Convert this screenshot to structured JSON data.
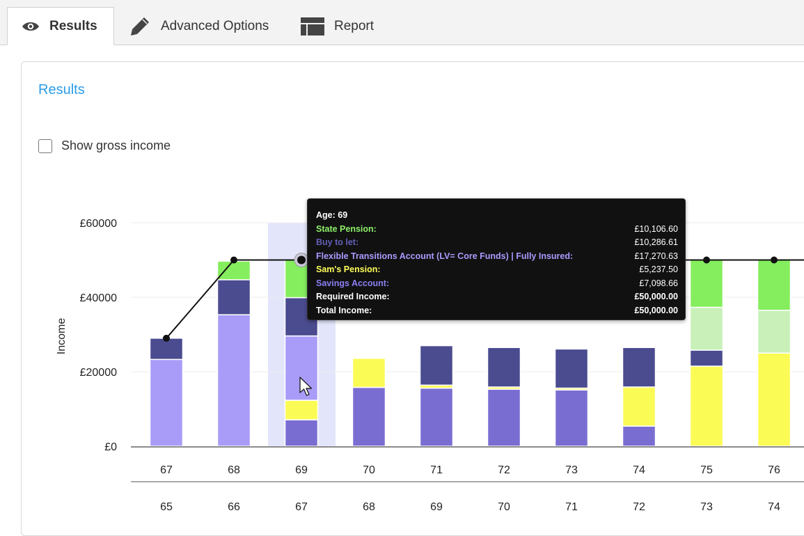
{
  "tabs": [
    {
      "label": "Results",
      "icon": "eye-icon",
      "active": true
    },
    {
      "label": "Advanced Options",
      "icon": "pencil-icon",
      "active": false
    },
    {
      "label": "Report",
      "icon": "table-icon",
      "active": false
    }
  ],
  "results": {
    "title": "Results",
    "show_gross_label": "Show gross income",
    "show_gross_checked": false
  },
  "tooltip": {
    "age_label": "Age:",
    "age_value": "69",
    "rows": [
      {
        "label": "State Pension:",
        "value": "£10,106.60",
        "color": "#8ef06a"
      },
      {
        "label": "Buy to let:",
        "value": "£10,286.61",
        "color": "#6360b8"
      },
      {
        "label": "Flexible Transitions Account (LV= Core Funds) | Fully Insured:",
        "value": "£17,270.63",
        "color": "#a99bff"
      },
      {
        "label": "Sam's Pension:",
        "value": "£5,237.50",
        "color": "#ffff5a"
      },
      {
        "label": "Savings Account:",
        "value": "£7,098.66",
        "color": "#8a7ff0"
      },
      {
        "label": "Required Income:",
        "value": "£50,000.00",
        "color": "#ffffff"
      },
      {
        "label": "Total Income:",
        "value": "£50,000.00",
        "color": "#ffffff"
      }
    ]
  },
  "chart_data": {
    "type": "bar",
    "stacked": true,
    "ylabel": "Income",
    "ylim": [
      0,
      60000
    ],
    "y_ticks": [
      "£0",
      "£20000",
      "£40000",
      "£60000"
    ],
    "y_tick_values": [
      0,
      20000,
      40000,
      60000
    ],
    "categories": [
      "67",
      "68",
      "69",
      "70",
      "71",
      "72",
      "73",
      "74",
      "75",
      "76"
    ],
    "secondary_categories": [
      "65",
      "66",
      "67",
      "68",
      "69",
      "70",
      "71",
      "72",
      "73",
      "74"
    ],
    "highlight_index": 2,
    "series": [
      {
        "key": "savings",
        "color": "#7a6dd2",
        "values": [
          0,
          0,
          7099,
          15800,
          15600,
          15300,
          15100,
          5400,
          0,
          0
        ]
      },
      {
        "key": "sams",
        "color": "#fbfb55",
        "values": [
          0,
          0,
          5238,
          7800,
          800,
          600,
          500,
          10500,
          21500,
          25000
        ]
      },
      {
        "key": "flex",
        "color": "#a89cf8",
        "values": [
          23300,
          35300,
          17271,
          0,
          0,
          0,
          0,
          0,
          0,
          0
        ]
      },
      {
        "key": "buytolet",
        "color": "#4b4b90",
        "values": [
          5700,
          9400,
          10287,
          0,
          10600,
          10600,
          10500,
          10600,
          4300,
          0
        ]
      },
      {
        "key": "palegreen",
        "color": "#c8f0b8",
        "values": [
          0,
          0,
          0,
          0,
          0,
          0,
          0,
          0,
          11500,
          11500
        ]
      },
      {
        "key": "state",
        "color": "#85ee5e",
        "values": [
          0,
          5000,
          10107,
          0,
          0,
          0,
          0,
          0,
          12700,
          13500
        ]
      }
    ],
    "required_income": [
      29000,
      50000,
      50000,
      50000,
      50000,
      50000,
      50000,
      50000,
      50000,
      50000
    ]
  }
}
